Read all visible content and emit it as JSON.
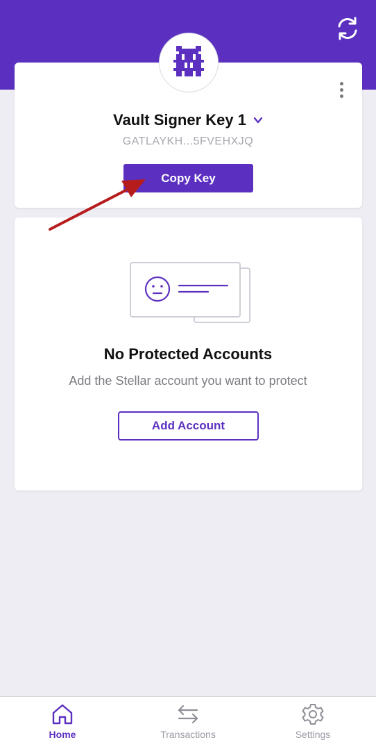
{
  "colors": {
    "accent": "#5b30c0",
    "arrow": "#b71c1c"
  },
  "header": {
    "refresh_icon": "refresh-icon"
  },
  "key_card": {
    "avatar_icon": "pixel-identicon",
    "name": "Vault Signer Key 1",
    "address": "GATLAYKH...5FVEHXJQ",
    "copy_label": "Copy Key",
    "menu_icon": "more-vertical-icon"
  },
  "empty_state": {
    "illustration": "account-card-illustration",
    "title": "No Protected Accounts",
    "subtitle": "Add the Stellar account you want to protect",
    "add_label": "Add Account"
  },
  "tabs": [
    {
      "label": "Home",
      "icon": "home-icon",
      "active": true
    },
    {
      "label": "Transactions",
      "icon": "transfer-arrows-icon",
      "active": false
    },
    {
      "label": "Settings",
      "icon": "gear-icon",
      "active": false
    }
  ]
}
